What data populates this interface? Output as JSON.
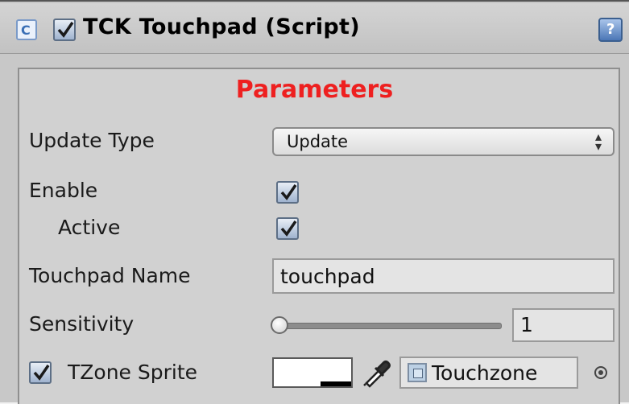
{
  "component": {
    "title": "TCK Touchpad (Script)",
    "enabled": true,
    "script_icon": "script-icon",
    "help_icon": "help-icon"
  },
  "section": {
    "title": "Parameters"
  },
  "fields": {
    "update_type": {
      "label": "Update Type",
      "value": "Update",
      "arrow_icon": "updown-arrows-icon"
    },
    "enable": {
      "label": "Enable",
      "checked": true
    },
    "active": {
      "label": "Active",
      "checked": true
    },
    "touchpad_name": {
      "label": "Touchpad Name",
      "value": "touchpad"
    },
    "sensitivity": {
      "label": "Sensitivity",
      "value": "1",
      "slider_fraction": 0.0
    },
    "tzone_sprite": {
      "label": "TZone Sprite",
      "checked": true,
      "color": "#ffffff",
      "object_value": "Touchzone",
      "picker_icon": "eyedropper-icon",
      "target_icon": "object-picker-icon"
    }
  },
  "colors": {
    "section_title": "#ee2020",
    "checkbox_fill": "#9fb3cf"
  }
}
